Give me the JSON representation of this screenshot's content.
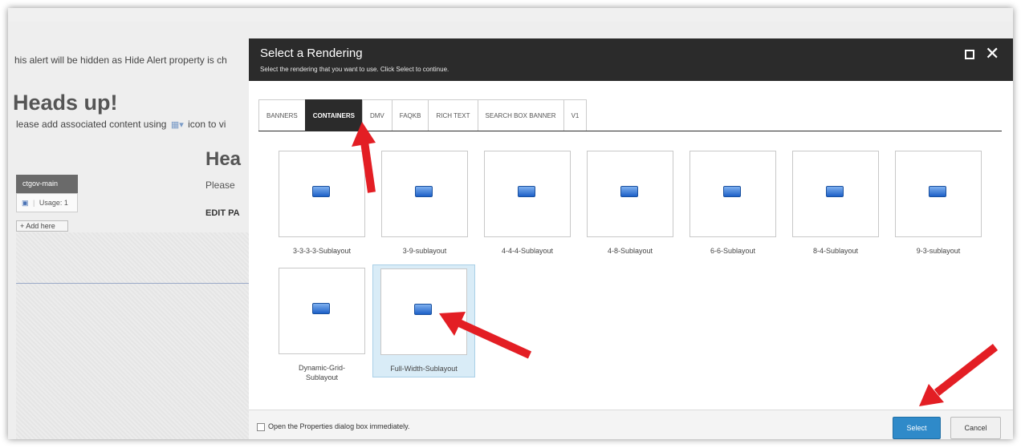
{
  "page": {
    "alert_text": "his alert will be hidden as Hide Alert property is ch",
    "heading": "Heads up!",
    "please_prefix": "lease add associated content using",
    "please_suffix": "icon to vi",
    "heading2": "Hea",
    "please2": "Please",
    "edit": "EDIT PA",
    "placeholder_name": "ctgov-main",
    "usage": "Usage: 1",
    "add_here": "+ Add here"
  },
  "dialog": {
    "title": "Select a Rendering",
    "subtitle": "Select the rendering that you want to use. Click Select to continue.",
    "tabs": [
      {
        "label": "BANNERS"
      },
      {
        "label": "CONTAINERS",
        "active": true
      },
      {
        "label": "DMV"
      },
      {
        "label": "FAQKB"
      },
      {
        "label": "RICH TEXT"
      },
      {
        "label": "SEARCH BOX BANNER"
      },
      {
        "label": "V1"
      }
    ],
    "renderings": [
      {
        "label": "3-3-3-3-Sublayout"
      },
      {
        "label": "3-9-sublayout"
      },
      {
        "label": "4-4-4-Sublayout"
      },
      {
        "label": "4-8-Sublayout"
      },
      {
        "label": "6-6-Sublayout"
      },
      {
        "label": "8-4-Sublayout"
      },
      {
        "label": "9-3-sublayout"
      },
      {
        "label": "Dynamic-Grid-Sublayout"
      },
      {
        "label": "Full-Width-Sublayout",
        "selected": true
      }
    ],
    "checkbox_label": "Open the Properties dialog box immediately.",
    "select_label": "Select",
    "cancel_label": "Cancel"
  },
  "colors": {
    "header_bg": "#2b2b2b",
    "select_button": "#2f8ac9",
    "selected_tile": "#d9ecf7",
    "annotation_arrow": "#e31e24"
  },
  "icons": [
    "rendering-icon",
    "add-component-icon",
    "maximize-icon",
    "close-icon",
    "annotation-arrow"
  ]
}
